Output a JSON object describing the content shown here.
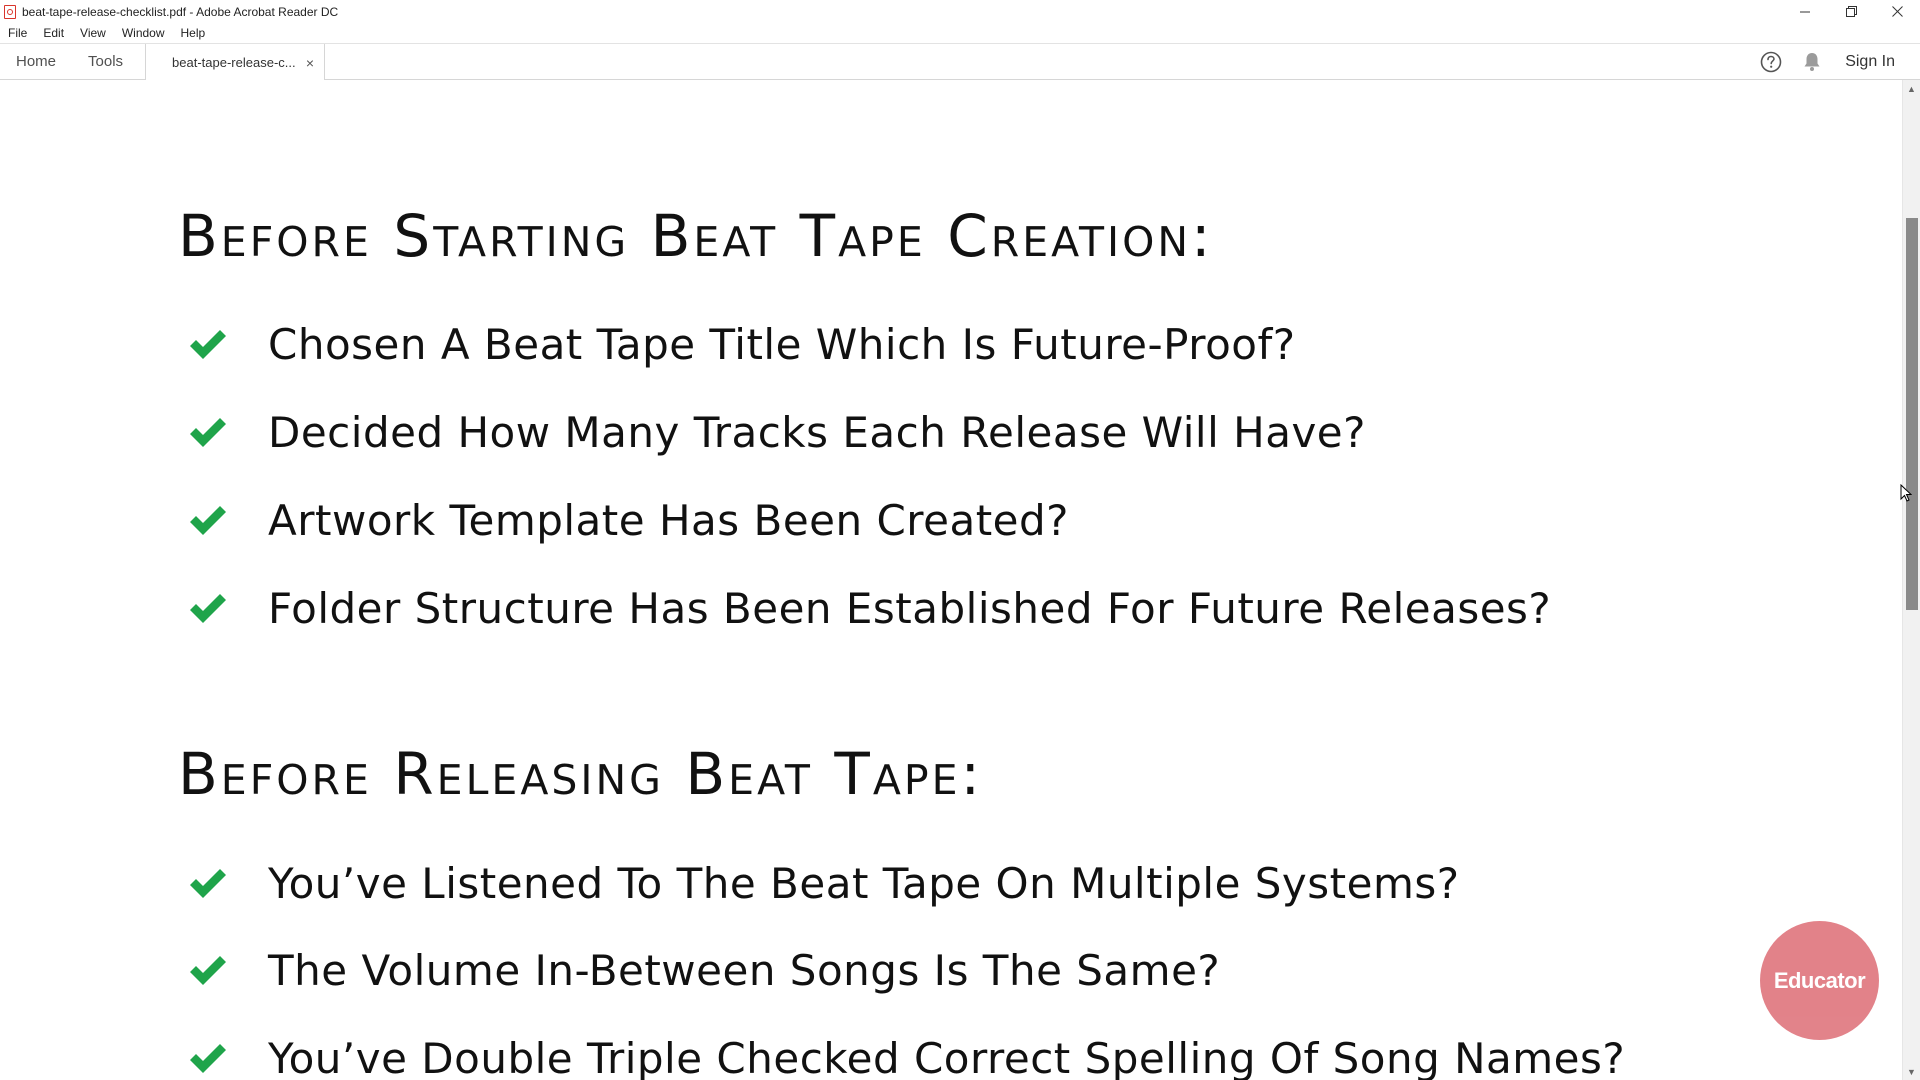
{
  "window": {
    "title": "beat-tape-release-checklist.pdf - Adobe Acrobat Reader DC",
    "minimize_label": "–",
    "restore_label": "❐",
    "close_label": "✕"
  },
  "menu": {
    "items": [
      "File",
      "Edit",
      "View",
      "Window",
      "Help"
    ]
  },
  "tabs": {
    "home_label": "Home",
    "tools_label": "Tools",
    "doc_tab_label": "beat-tape-release-c...",
    "doc_tab_close": "×",
    "sign_in_label": "Sign In",
    "help_icon": "help-icon",
    "bell_icon": "bell-icon"
  },
  "document": {
    "sections": [
      {
        "heading": "Before Starting Beat Tape Creation:",
        "items": [
          "Chosen A Beat Tape Title Which Is Future-Proof?",
          "Decided How Many Tracks Each Release Will Have?",
          "Artwork Template Has Been Created?",
          "Folder Structure Has Been Established For Future Releases?"
        ]
      },
      {
        "heading": "Before Releasing Beat Tape:",
        "items": [
          "You’ve Listened To The Beat Tape On Multiple Systems?",
          "The Volume In-Between Songs Is The Same?",
          "You’ve Double Triple Checked Correct Spelling Of Song Names?"
        ]
      }
    ],
    "check_color": "#1fa44a"
  },
  "badge": {
    "label": "Educator",
    "color": "#e07880"
  }
}
